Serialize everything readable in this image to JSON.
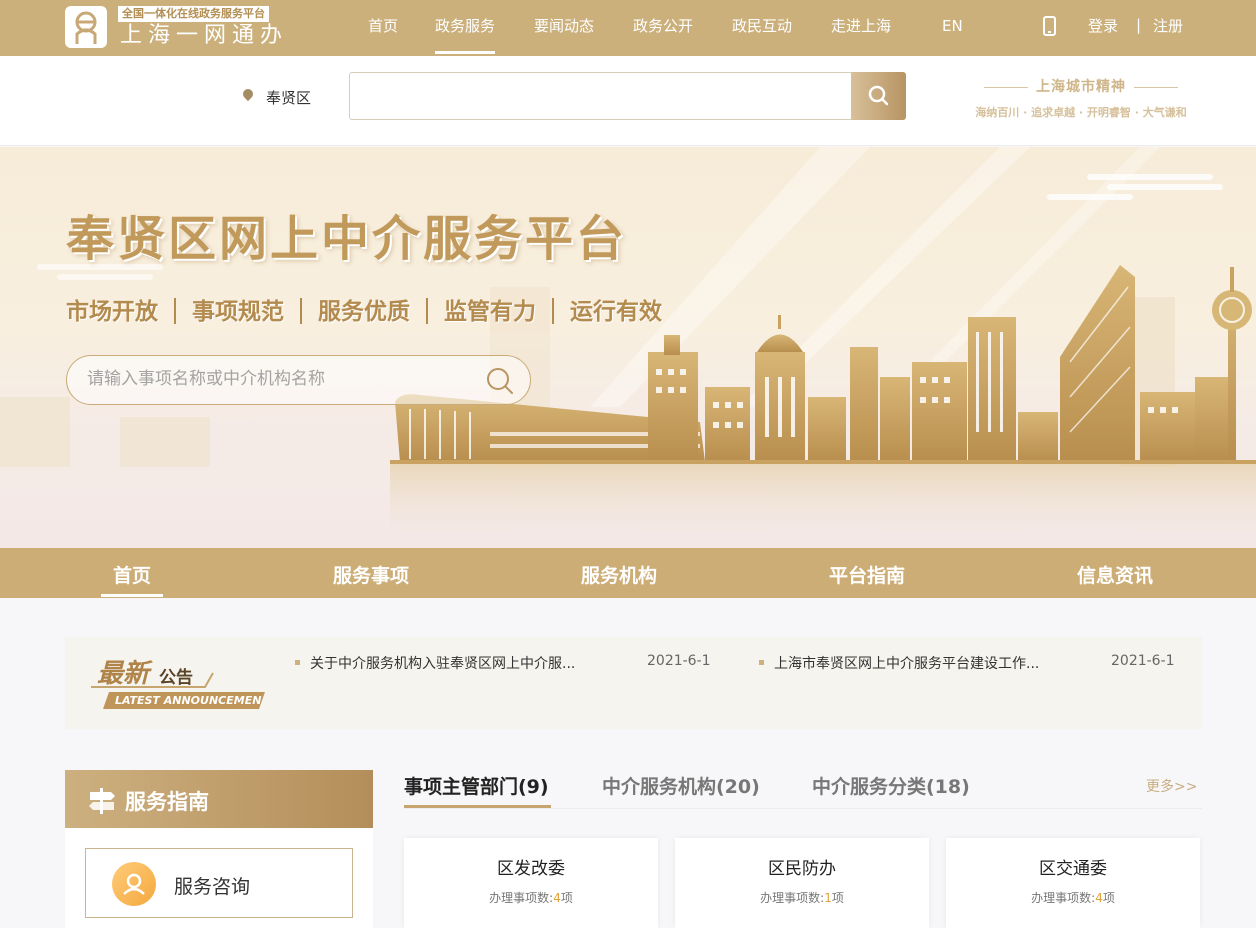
{
  "header": {
    "logo_tagline": "全国一体化在线政务服务平台",
    "logo_name": "上海一网通办",
    "nav": [
      "首页",
      "政务服务",
      "要闻动态",
      "政务公开",
      "政民互动",
      "走进上海",
      "EN"
    ],
    "active_nav": "政务服务",
    "login": "登录",
    "register": "注册",
    "separator": "|"
  },
  "search_bar": {
    "location": "奉贤区",
    "value": "",
    "spirit_title": "上海城市精神",
    "spirit_sub": "海纳百川 · 追求卓越 · 开明睿智 · 大气谦和"
  },
  "banner": {
    "title": "奉贤区网上中介服务平台",
    "slogans": [
      "市场开放",
      "事项规范",
      "服务优质",
      "监管有力",
      "运行有效"
    ],
    "search_placeholder": "请输入事项名称或中介机构名称"
  },
  "subnav": {
    "items": [
      "首页",
      "服务事项",
      "服务机构",
      "平台指南",
      "信息资讯"
    ],
    "active": "首页"
  },
  "announcements": {
    "label_big": "最新",
    "label_small": "公告",
    "label_en": "LATEST ANNOUNCEMEN",
    "items": [
      {
        "title": "关于中介服务机构入驻奉贤区网上中介服...",
        "date": "2021-6-1"
      },
      {
        "title": "上海市奉贤区网上中介服务平台建设工作...",
        "date": "2021-6-1"
      }
    ]
  },
  "service_guide": {
    "title": "服务指南",
    "items": [
      "服务咨询"
    ]
  },
  "tabs": {
    "items": [
      "事项主管部门(9)",
      "中介服务机构(20)",
      "中介服务分类(18)"
    ],
    "active": "事项主管部门(9)",
    "more": "更多>>"
  },
  "departments": [
    {
      "name": "区发改委",
      "label": "办理事项数:",
      "count": "4",
      "unit": "项"
    },
    {
      "name": "区民防办",
      "label": "办理事项数:",
      "count": "1",
      "unit": "项"
    },
    {
      "name": "区交通委",
      "label": "办理事项数:",
      "count": "4",
      "unit": "项"
    }
  ],
  "colors": {
    "gold": "#cbb07c",
    "banner_text": "#c19a5b",
    "count_highlight": "#e0a33a"
  }
}
